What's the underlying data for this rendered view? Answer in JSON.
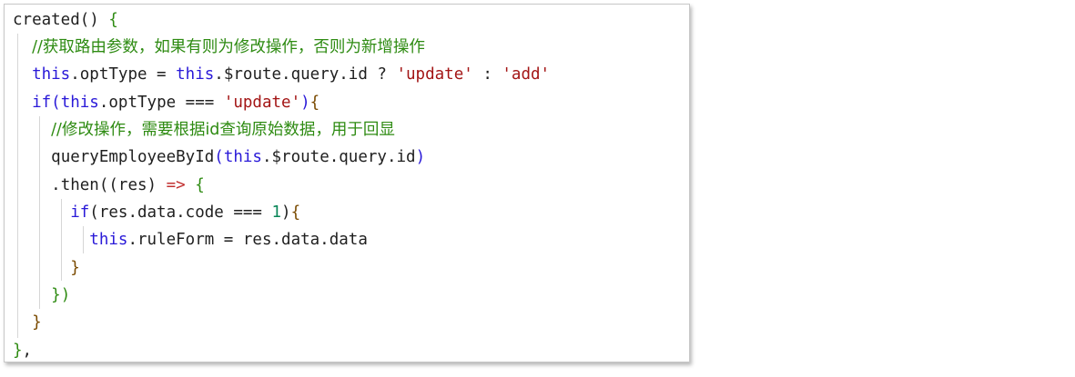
{
  "code": {
    "lines": [
      {
        "tokens": [
          {
            "t": "created",
            "c": "plain"
          },
          {
            "t": "() ",
            "c": "plain"
          },
          {
            "t": "{",
            "c": "brace-green"
          }
        ]
      },
      {
        "tokens": [
          {
            "t": "  ",
            "c": "plain"
          },
          {
            "t": "//获取路由参数，如果有则为修改操作，否则为新增操作",
            "c": "comment"
          }
        ]
      },
      {
        "tokens": [
          {
            "t": "  ",
            "c": "plain"
          },
          {
            "t": "this",
            "c": "kw"
          },
          {
            "t": ".optType = ",
            "c": "plain"
          },
          {
            "t": "this",
            "c": "kw"
          },
          {
            "t": ".$route.query.id ? ",
            "c": "plain"
          },
          {
            "t": "'update'",
            "c": "str"
          },
          {
            "t": " : ",
            "c": "plain"
          },
          {
            "t": "'add'",
            "c": "str"
          }
        ]
      },
      {
        "tokens": [
          {
            "t": "  ",
            "c": "plain"
          },
          {
            "t": "if",
            "c": "kw"
          },
          {
            "t": "(",
            "c": "paren-blue"
          },
          {
            "t": "this",
            "c": "kw"
          },
          {
            "t": ".optType === ",
            "c": "plain"
          },
          {
            "t": "'update'",
            "c": "str"
          },
          {
            "t": ")",
            "c": "paren-blue"
          },
          {
            "t": "{",
            "c": "brace-brown"
          }
        ]
      },
      {
        "tokens": [
          {
            "t": "    ",
            "c": "plain"
          },
          {
            "t": "//修改操作，需要根据id查询原始数据，用于回显",
            "c": "comment"
          }
        ]
      },
      {
        "tokens": [
          {
            "t": "    ",
            "c": "plain"
          },
          {
            "t": "queryEmployeeById",
            "c": "plain"
          },
          {
            "t": "(",
            "c": "paren-blue"
          },
          {
            "t": "this",
            "c": "kw"
          },
          {
            "t": ".$route.query.id",
            "c": "plain"
          },
          {
            "t": ")",
            "c": "paren-blue"
          }
        ]
      },
      {
        "tokens": [
          {
            "t": "    ",
            "c": "plain"
          },
          {
            "t": ".then(",
            "c": "plain"
          },
          {
            "t": "(res) ",
            "c": "plain"
          },
          {
            "t": "=>",
            "c": "arrow"
          },
          {
            "t": " ",
            "c": "plain"
          },
          {
            "t": "{",
            "c": "brace-green"
          }
        ]
      },
      {
        "tokens": [
          {
            "t": "      ",
            "c": "plain"
          },
          {
            "t": "if",
            "c": "kw"
          },
          {
            "t": "(res.data.code === ",
            "c": "plain"
          },
          {
            "t": "1",
            "c": "num"
          },
          {
            "t": ")",
            "c": "plain"
          },
          {
            "t": "{",
            "c": "brace-brown"
          }
        ]
      },
      {
        "tokens": [
          {
            "t": "        ",
            "c": "plain"
          },
          {
            "t": "this",
            "c": "kw"
          },
          {
            "t": ".ruleForm = res.data.data",
            "c": "plain"
          }
        ]
      },
      {
        "tokens": [
          {
            "t": "      ",
            "c": "plain"
          },
          {
            "t": "}",
            "c": "brace-brown"
          }
        ]
      },
      {
        "tokens": [
          {
            "t": "    ",
            "c": "plain"
          },
          {
            "t": "})",
            "c": "brace-green"
          }
        ]
      },
      {
        "tokens": [
          {
            "t": "  ",
            "c": "plain"
          },
          {
            "t": "}",
            "c": "brace-brown"
          }
        ]
      },
      {
        "tokens": [
          {
            "t": "}",
            "c": "brace-green"
          },
          {
            "t": ",",
            "c": "plain"
          }
        ]
      }
    ]
  },
  "colors": {
    "keyword": "#2a1ad8",
    "string": "#a31515",
    "comment": "#2e8b12",
    "number": "#098658",
    "text": "#1f1f1f"
  }
}
